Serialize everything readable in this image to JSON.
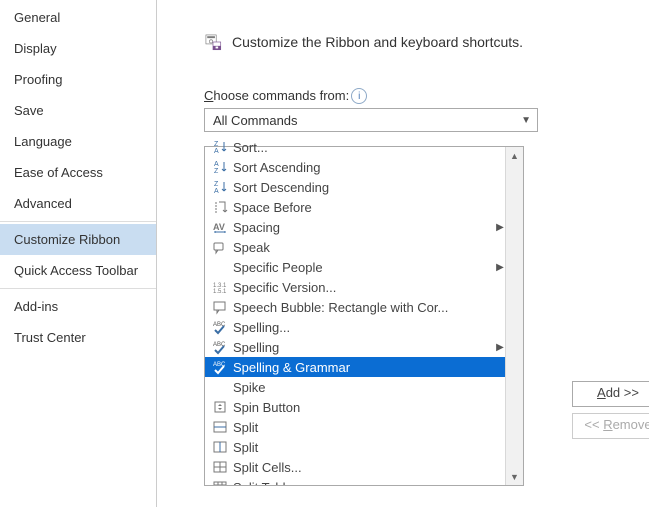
{
  "nav": {
    "items": [
      {
        "label": "General"
      },
      {
        "label": "Display"
      },
      {
        "label": "Proofing"
      },
      {
        "label": "Save"
      },
      {
        "label": "Language"
      },
      {
        "label": "Ease of Access"
      },
      {
        "label": "Advanced"
      },
      {
        "label": "Customize Ribbon",
        "selected": true
      },
      {
        "label": "Quick Access Toolbar"
      },
      {
        "label": "Add-ins"
      },
      {
        "label": "Trust Center"
      }
    ],
    "separators_after": [
      6,
      8
    ]
  },
  "header": {
    "title": "Customize the Ribbon and keyboard shortcuts."
  },
  "choose": {
    "label_prefix": "C",
    "label_rest": "hoose commands from:",
    "info": "i",
    "value": "All Commands"
  },
  "commands": {
    "items": [
      {
        "icon": "sort-za",
        "label": "Sort...",
        "submenu": false
      },
      {
        "icon": "sort-az",
        "label": "Sort Ascending",
        "submenu": false
      },
      {
        "icon": "sort-za",
        "label": "Sort Descending",
        "submenu": false
      },
      {
        "icon": "para",
        "label": "Space Before",
        "submenu": false
      },
      {
        "icon": "av",
        "label": "Spacing",
        "submenu": true
      },
      {
        "icon": "speak",
        "label": "Speak",
        "submenu": false
      },
      {
        "icon": "",
        "label": "Specific People",
        "submenu": true
      },
      {
        "icon": "ver",
        "label": "Specific Version...",
        "submenu": false
      },
      {
        "icon": "bubble",
        "label": "Speech Bubble: Rectangle with Cor...",
        "submenu": false
      },
      {
        "icon": "abc-check",
        "label": "Spelling...",
        "submenu": false
      },
      {
        "icon": "abc-check",
        "label": "Spelling",
        "submenu": true
      },
      {
        "icon": "abc-check",
        "label": "Spelling & Grammar",
        "submenu": false,
        "selected": true
      },
      {
        "icon": "",
        "label": "Spike",
        "submenu": false
      },
      {
        "icon": "spin",
        "label": "Spin Button",
        "submenu": false
      },
      {
        "icon": "split-h",
        "label": "Split",
        "submenu": false
      },
      {
        "icon": "split-v",
        "label": "Split",
        "submenu": false
      },
      {
        "icon": "cells",
        "label": "Split Cells...",
        "submenu": false
      },
      {
        "icon": "table",
        "label": "Split Table",
        "submenu": false
      }
    ]
  },
  "buttons": {
    "add_prefix": "A",
    "add_rest": "dd >>",
    "remove_prefix": "<< ",
    "remove_u": "R",
    "remove_rest": "emove"
  }
}
